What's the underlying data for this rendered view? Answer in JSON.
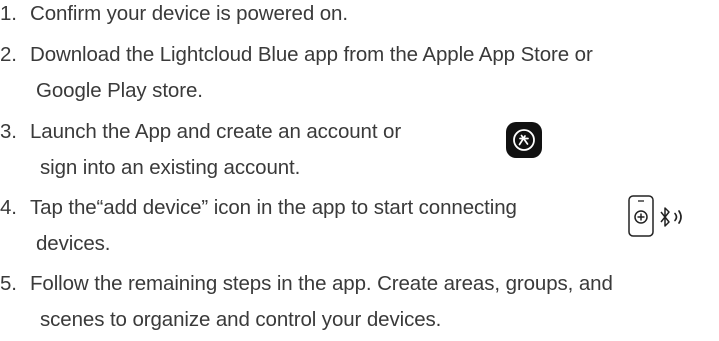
{
  "steps": [
    {
      "number": "1.",
      "lines": [
        "Confirm your device is powered on."
      ]
    },
    {
      "number": "2.",
      "lines": [
        "Download the Lightcloud Blue app from the Apple App Store or",
        "Google Play store."
      ]
    },
    {
      "number": "3.",
      "lines": [
        "Launch the App and create an account or",
        "sign into an existing account."
      ],
      "icon": "lightcloud-app-icon"
    },
    {
      "number": "4.",
      "lines": [
        "Tap the“add device” icon in the app to start connecting",
        "devices."
      ],
      "icon": "add-device-bluetooth-icon"
    },
    {
      "number": "5.",
      "lines": [
        "Follow the remaining steps in the app. Create areas, groups, and",
        "scenes to organize and control your devices."
      ]
    }
  ],
  "colors": {
    "text": "#3a3a3a",
    "icon_fill": "#111111"
  }
}
